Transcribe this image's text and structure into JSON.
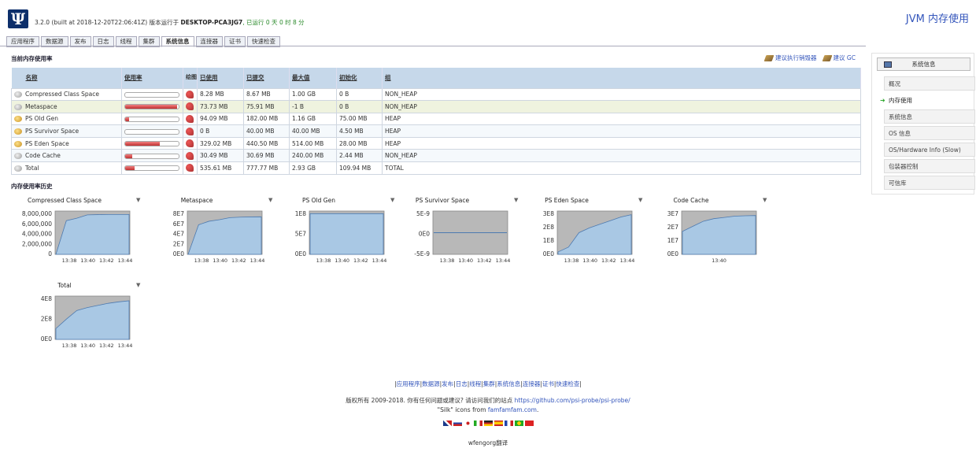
{
  "header": {
    "build_prefix": "3.2.0 (built at 2018-12-20T22:06:41Z) 版本运行于 ",
    "host": "DESKTOP-PCA3JG7",
    "uptime": ", 已运行 0 天 0 时 8 分",
    "title": "JVM 内存使用"
  },
  "tabs": [
    "应用程序",
    "数据源",
    "发布",
    "日志",
    "线程",
    "集群",
    "系统信息",
    "连接器",
    "证书",
    "快速检查"
  ],
  "active_tab": "系统信息",
  "section_current": "当前内存使用率",
  "section_history": "内存使用率历史",
  "gc": {
    "advise_label": "建议执行销毁器",
    "gc_label": "建议 GC"
  },
  "table": {
    "headers": [
      "名称",
      "使用率",
      "绘图",
      "已使用",
      "已提交",
      "最大值",
      "初始化",
      "组"
    ],
    "rows": [
      {
        "name": "Compressed Class Space",
        "type": "nonheap",
        "usage": 0.0,
        "used": "8.28 MB",
        "committed": "8.67 MB",
        "max": "1.00 GB",
        "init": "0 B",
        "group": "NON_HEAP"
      },
      {
        "name": "Metaspace",
        "type": "nonheap",
        "usage": 0.97,
        "used": "73.73 MB",
        "committed": "75.91 MB",
        "max": "-1 B",
        "init": "0 B",
        "group": "NON_HEAP"
      },
      {
        "name": "PS Old Gen",
        "type": "heap",
        "usage": 0.08,
        "used": "94.09 MB",
        "committed": "182.00 MB",
        "max": "1.16 GB",
        "init": "75.00 MB",
        "group": "HEAP"
      },
      {
        "name": "PS Survivor Space",
        "type": "heap",
        "usage": 0.0,
        "used": "0 B",
        "committed": "40.00 MB",
        "max": "40.00 MB",
        "init": "4.50 MB",
        "group": "HEAP"
      },
      {
        "name": "PS Eden Space",
        "type": "heap",
        "usage": 0.64,
        "used": "329.02 MB",
        "committed": "440.50 MB",
        "max": "514.00 MB",
        "init": "28.00 MB",
        "group": "HEAP"
      },
      {
        "name": "Code Cache",
        "type": "nonheap",
        "usage": 0.13,
        "used": "30.49 MB",
        "committed": "30.69 MB",
        "max": "240.00 MB",
        "init": "2.44 MB",
        "group": "NON_HEAP"
      },
      {
        "name": "Total",
        "type": "nonheap",
        "usage": 0.18,
        "used": "535.61 MB",
        "committed": "777.77 MB",
        "max": "2.93 GB",
        "init": "109.94 MB",
        "group": "TOTAL"
      }
    ]
  },
  "chart_data": [
    {
      "type": "area",
      "title": "Compressed Class Space",
      "yticks": [
        "8,000,000",
        "6,000,000",
        "4,000,000",
        "2,000,000",
        "0"
      ],
      "xticks": [
        "13:38",
        "13:40",
        "13:42",
        "13:44"
      ],
      "ylim": [
        0,
        9000000
      ],
      "y": [
        0,
        7000000,
        7500000,
        8200000,
        8250000,
        8280000,
        8280000,
        8280000
      ]
    },
    {
      "type": "area",
      "title": "Metaspace",
      "yticks": [
        "8E7",
        "6E7",
        "4E7",
        "2E7",
        "0E0"
      ],
      "xticks": [
        "13:38",
        "13:40",
        "13:42",
        "13:44"
      ],
      "ylim": [
        0,
        85000000
      ],
      "y": [
        0,
        58000000,
        65000000,
        68000000,
        72000000,
        73000000,
        73500000,
        73700000
      ]
    },
    {
      "type": "area",
      "title": "PS Old Gen",
      "yticks": [
        "1E8",
        "5E7",
        "0E0"
      ],
      "xticks": [
        "13:38",
        "13:40",
        "13:42",
        "13:44"
      ],
      "ylim": [
        0,
        100000000
      ],
      "y": [
        94000000,
        94000000,
        94000000,
        94000000,
        94000000,
        94000000,
        94000000,
        94000000
      ]
    },
    {
      "type": "line",
      "title": "PS Survivor Space",
      "yticks": [
        "5E-9",
        "0E0",
        "-5E-9"
      ],
      "xticks": [
        "13:38",
        "13:40",
        "13:42",
        "13:44"
      ],
      "ylim": [
        -5e-09,
        5e-09
      ],
      "y": [
        0,
        0,
        0,
        0,
        0,
        0,
        0,
        0
      ]
    },
    {
      "type": "area",
      "title": "PS Eden Space",
      "yticks": [
        "3E8",
        "2E8",
        "1E8",
        "0E0"
      ],
      "xticks": [
        "13:38",
        "13:40",
        "13:42",
        "13:44"
      ],
      "ylim": [
        0,
        360000000
      ],
      "y": [
        20000000,
        60000000,
        180000000,
        220000000,
        250000000,
        280000000,
        310000000,
        330000000
      ]
    },
    {
      "type": "area",
      "title": "Code Cache",
      "yticks": [
        "3E7",
        "2E7",
        "1E7",
        "0E0"
      ],
      "xticks": [
        "13:40"
      ],
      "ylim": [
        0,
        34000000
      ],
      "y": [
        18000000,
        22000000,
        26000000,
        28000000,
        29000000,
        30000000,
        30300000,
        30490000
      ]
    },
    {
      "type": "area",
      "title": "Total",
      "yticks": [
        "4E8",
        "2E8",
        "0E0"
      ],
      "xticks": [
        "13:38",
        "13:40",
        "13:42",
        "13:44"
      ],
      "ylim": [
        0,
        600000000
      ],
      "y": [
        150000000,
        280000000,
        400000000,
        440000000,
        470000000,
        500000000,
        520000000,
        535000000
      ]
    }
  ],
  "sidebar": {
    "header": "系统信息",
    "items": [
      "概况",
      "内存使用",
      "系统信息",
      "OS 信息",
      "OS/Hardware Info (Slow)",
      "包装器控制",
      "可信库"
    ],
    "current": "内存使用"
  },
  "footer": {
    "links": [
      "应用程序",
      "数据源",
      "发布",
      "日志",
      "线程",
      "集群",
      "系统信息",
      "连接器",
      "证书",
      "快速检查"
    ],
    "copyright": "版权所有 2009-2018. 你有任何问题或建议? 请访问我们的站点 ",
    "site": "https://github.com/psi-probe/psi-probe/",
    "icons_prefix": "\"Silk\" icons from ",
    "icons_link": "famfamfam.com",
    "icons_suffix": ".",
    "translator": "wfengorg翻译"
  }
}
